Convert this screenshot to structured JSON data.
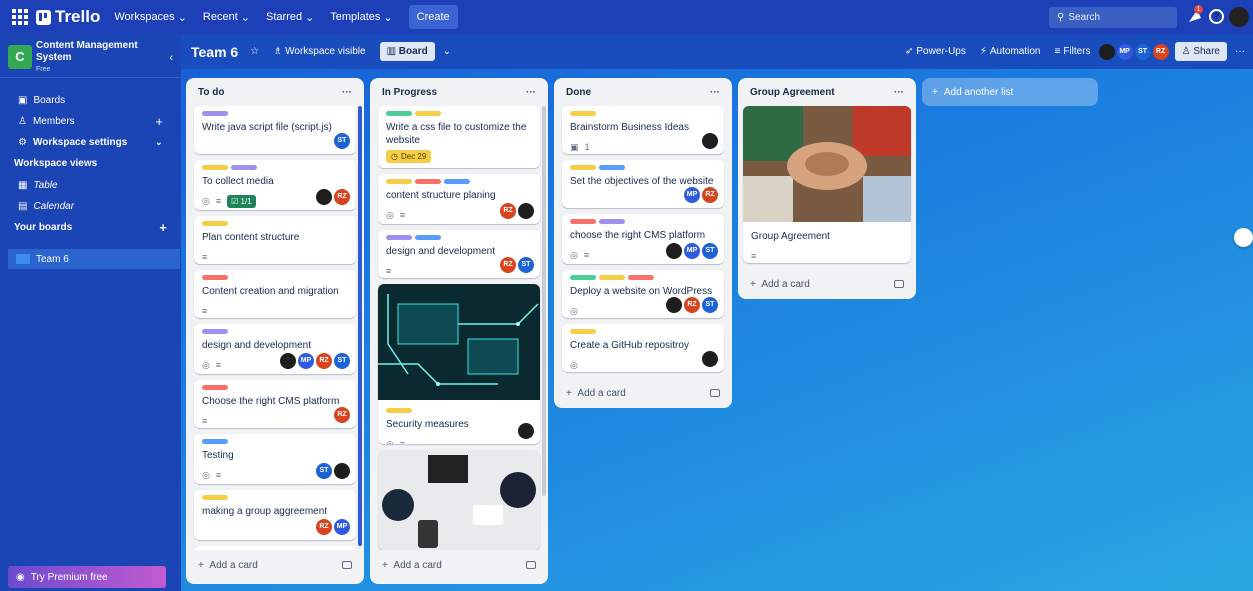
{
  "nav": {
    "logo": "Trello",
    "items": [
      "Workspaces",
      "Recent",
      "Starred",
      "Templates"
    ],
    "create": "Create",
    "search_placeholder": "Search",
    "notif_count": "1"
  },
  "sidebar": {
    "workspace_letter": "C",
    "workspace_name": "Content Management System",
    "workspace_plan": "Free",
    "items": [
      {
        "label": "Boards"
      },
      {
        "label": "Members"
      },
      {
        "label": "Workspace settings"
      }
    ],
    "views_title": "Workspace views",
    "views": [
      "Table",
      "Calendar"
    ],
    "your_boards": "Your boards",
    "team": "Team 6",
    "premium": "Try Premium free"
  },
  "board": {
    "name": "Team 6",
    "visibility": "Workspace visible",
    "view": "Board",
    "powerups": "Power-Ups",
    "automation": "Automation",
    "filters": "Filters",
    "share": "Share",
    "members": [
      "MP",
      "ST",
      "RZ"
    ]
  },
  "lists": {
    "todo": {
      "title": "To do",
      "add": "Add a card",
      "cards": [
        {
          "title": "Write java script file (script.js)"
        },
        {
          "title": "To collect media",
          "check": "1/1"
        },
        {
          "title": "Plan content structure"
        },
        {
          "title": "Content creation and migration"
        },
        {
          "title": "design and development"
        },
        {
          "title": "Choose the right CMS platform"
        },
        {
          "title": "Testing"
        },
        {
          "title": "making a group aggreement"
        }
      ]
    },
    "inprogress": {
      "title": "In Progress",
      "add": "Add a card",
      "cards": [
        {
          "title": "Write a css file to customize the website",
          "date": "Dec 29"
        },
        {
          "title": "content structure planing"
        },
        {
          "title": "design and development"
        },
        {
          "title": "Security measures"
        }
      ]
    },
    "done": {
      "title": "Done",
      "add": "Add a card",
      "cards": [
        {
          "title": "Brainstorm Business Ideas",
          "attach": "1"
        },
        {
          "title": "Set the objectives of the website"
        },
        {
          "title": "choose the right CMS platform"
        },
        {
          "title": "Deploy a website on WordPress"
        },
        {
          "title": "Create a GitHub repositroy"
        }
      ]
    },
    "group": {
      "title": "Group Agreement",
      "add": "Add a card",
      "cards": [
        {
          "title": "Group Agreement"
        }
      ]
    }
  },
  "add_list": "Add another list",
  "avatar_labels": {
    "st": "ST",
    "rz": "RZ",
    "mp": "MP"
  },
  "colors": {
    "purple": "#9f8fef",
    "yellow": "#f5cd47",
    "green": "#4bce97",
    "red": "#f87168",
    "blue": "#579dff"
  }
}
